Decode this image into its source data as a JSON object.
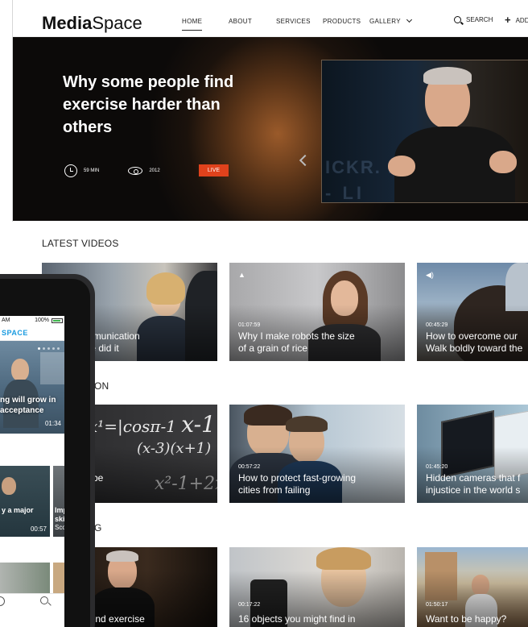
{
  "header": {
    "logo_bold": "Media",
    "logo_light": "Space",
    "nav": [
      {
        "label": "HOME"
      },
      {
        "label": "ABOUT"
      },
      {
        "label": "SERVICES"
      },
      {
        "label": "PRODUCTS"
      },
      {
        "label": "GALLERY"
      }
    ],
    "search_label": "SEARCH",
    "add_label": "ADD"
  },
  "hero": {
    "title": "Why some people find exercise harder than others",
    "duration": "59 MIN",
    "views": "2012",
    "live_label": "LIVE",
    "video_watermark_1": "ICKR. PL",
    "video_watermark_2": "- LI"
  },
  "sections": {
    "latest": "LATEST VIDEOS",
    "second_partial": "ON",
    "third_partial": "G"
  },
  "cards": {
    "r1c1": {
      "duration": "",
      "title": "brain communication\nd. How we did it"
    },
    "r1c2": {
      "duration": "01:07:59",
      "title": "Why I make robots the size\nof a grain of rice"
    },
    "r1c3": {
      "duration": "00:45:29",
      "title": "How to overcome our\nWalk boldly toward the"
    },
    "r2c1": {
      "duration": "",
      "title": "t altruism be\nde"
    },
    "r2c2": {
      "duration": "00:57:22",
      "title": "How to protect fast-growing\ncities from failing"
    },
    "r2c3": {
      "duration": "01:45:20",
      "title": "Hidden cameras that f\ninjustice in the world s"
    },
    "r3c1": {
      "duration": "",
      "title": "e people find exercise"
    },
    "r3c2": {
      "duration": "00:17:22",
      "title": "16 objects you might find in"
    },
    "r3c3": {
      "duration": "01:50:17",
      "title": "Want to be happy?"
    }
  },
  "phone": {
    "time": "AM",
    "battery": "100%",
    "brand": "SPACE",
    "hero_title": "ng will grow in\nacceptance",
    "hero_duration": "01:34",
    "card1_title": "y a major",
    "card1_duration": "00:57",
    "card2_title": "Impro\nskills",
    "card2_sub": "Scott M"
  },
  "colors": {
    "live": "#e0421c",
    "phone_brand": "#1a9be0"
  }
}
